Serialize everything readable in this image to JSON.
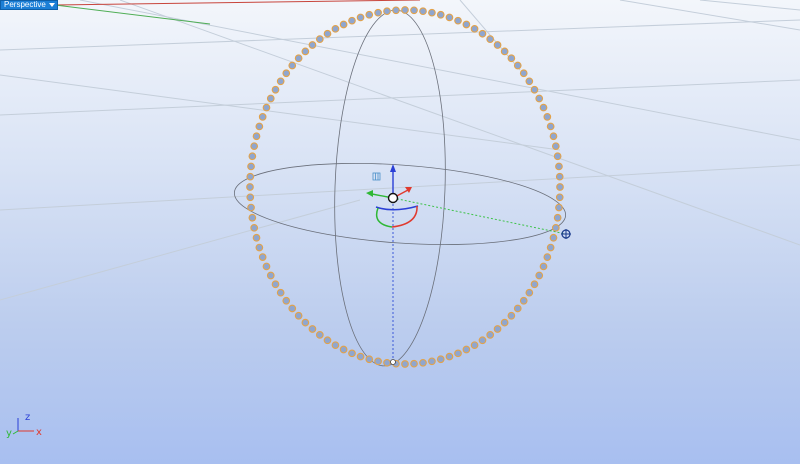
{
  "viewport": {
    "label": "Perspective",
    "name": "perspective-viewport"
  },
  "axes": {
    "x": "x",
    "y": "y",
    "z": "z",
    "colors": {
      "x": "#e03a2f",
      "y": "#2fb836",
      "z": "#2a3fd6"
    }
  },
  "gumball": {
    "colors": {
      "x": "#e03a2f",
      "y": "#2fb836",
      "z": "#2a3fd6"
    }
  },
  "objects": {
    "bead_color": "#8fa6cf",
    "bead_highlight": "#e2a24a",
    "bead_count": 108
  }
}
